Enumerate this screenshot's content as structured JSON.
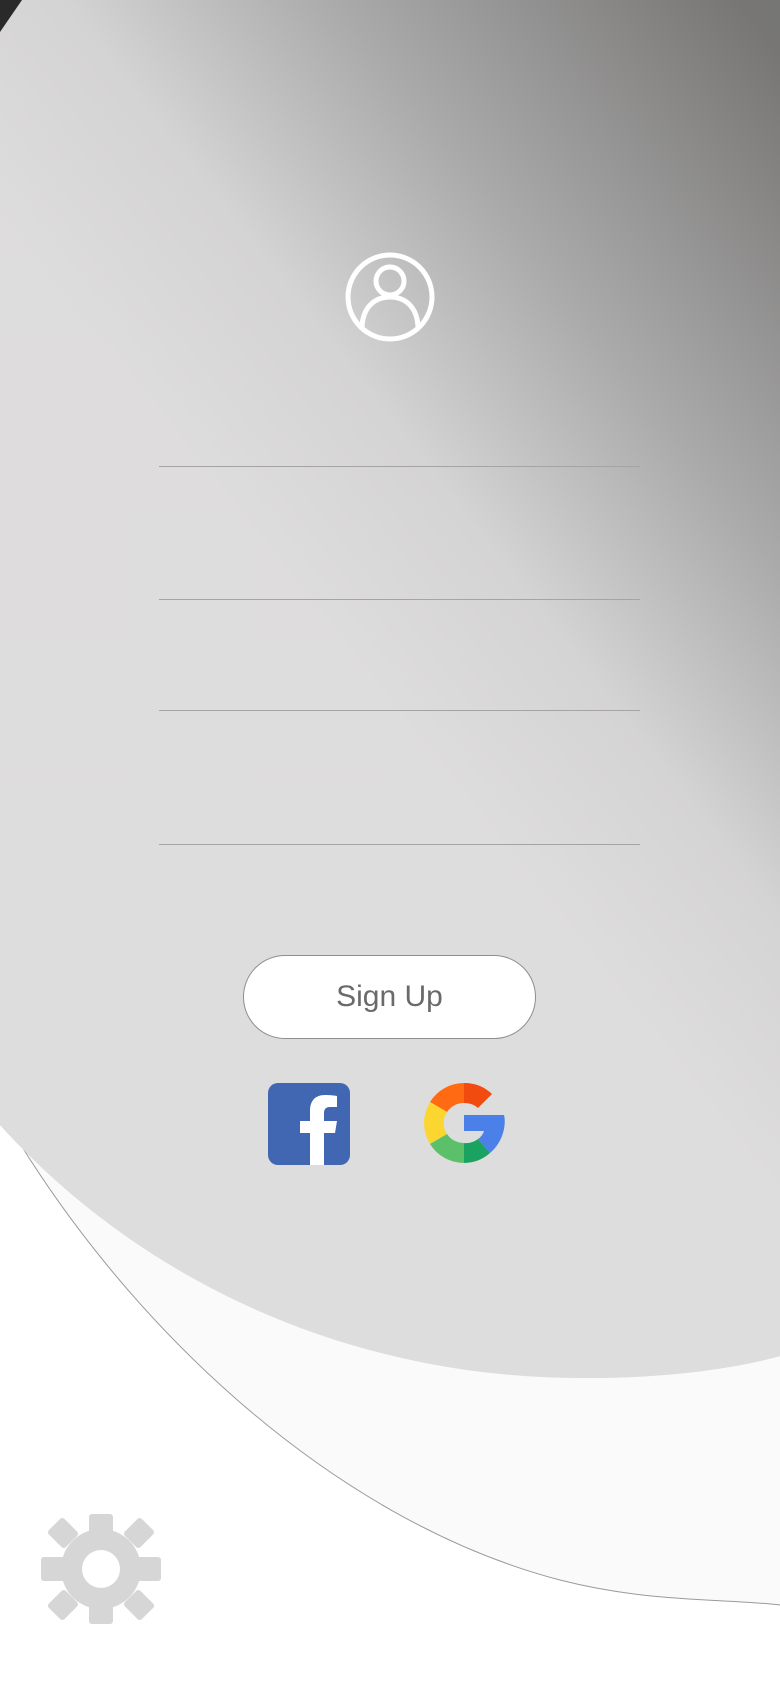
{
  "form": {
    "fields": [
      {
        "placeholder": ""
      },
      {
        "placeholder": ""
      },
      {
        "placeholder": ""
      }
    ],
    "signup_label": "Sign Up"
  },
  "social": {
    "facebook_icon": "facebook-icon",
    "google_icon": "google-icon"
  },
  "icons": {
    "avatar": "user-avatar-icon",
    "settings": "gear-icon"
  },
  "colors": {
    "facebook": "#4267b2",
    "google_blue": "#4a80e8",
    "google_red": "#f24b0f",
    "google_orange": "#ff6a13",
    "google_yellow": "#fbd631",
    "google_green": "#5cc06a",
    "gear": "#d6d6d6",
    "button_text": "#6a6a6a"
  }
}
